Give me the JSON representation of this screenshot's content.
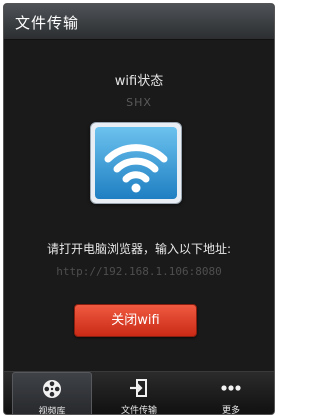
{
  "header": {
    "title": "文件传输"
  },
  "wifi": {
    "status_label": "wifi状态",
    "ssid": "SHX",
    "instruction": "请打开电脑浏览器，输入以下地址:",
    "address": "http://192.168.1.106:8080",
    "toggle_button": "关闭wifi",
    "icon": "wifi-icon"
  },
  "tabbar": {
    "tabs": [
      {
        "label": "视频库",
        "icon": "film-reel-icon",
        "active": true
      },
      {
        "label": "文件传输",
        "icon": "file-transfer-icon",
        "active": false
      },
      {
        "label": "更多",
        "icon": "more-dots-icon",
        "active": false
      }
    ]
  },
  "colors": {
    "background": "#1a1a1a",
    "button": "#e0402a",
    "tile": "#3aa0dd",
    "text_dim": "#5a5a5a"
  }
}
